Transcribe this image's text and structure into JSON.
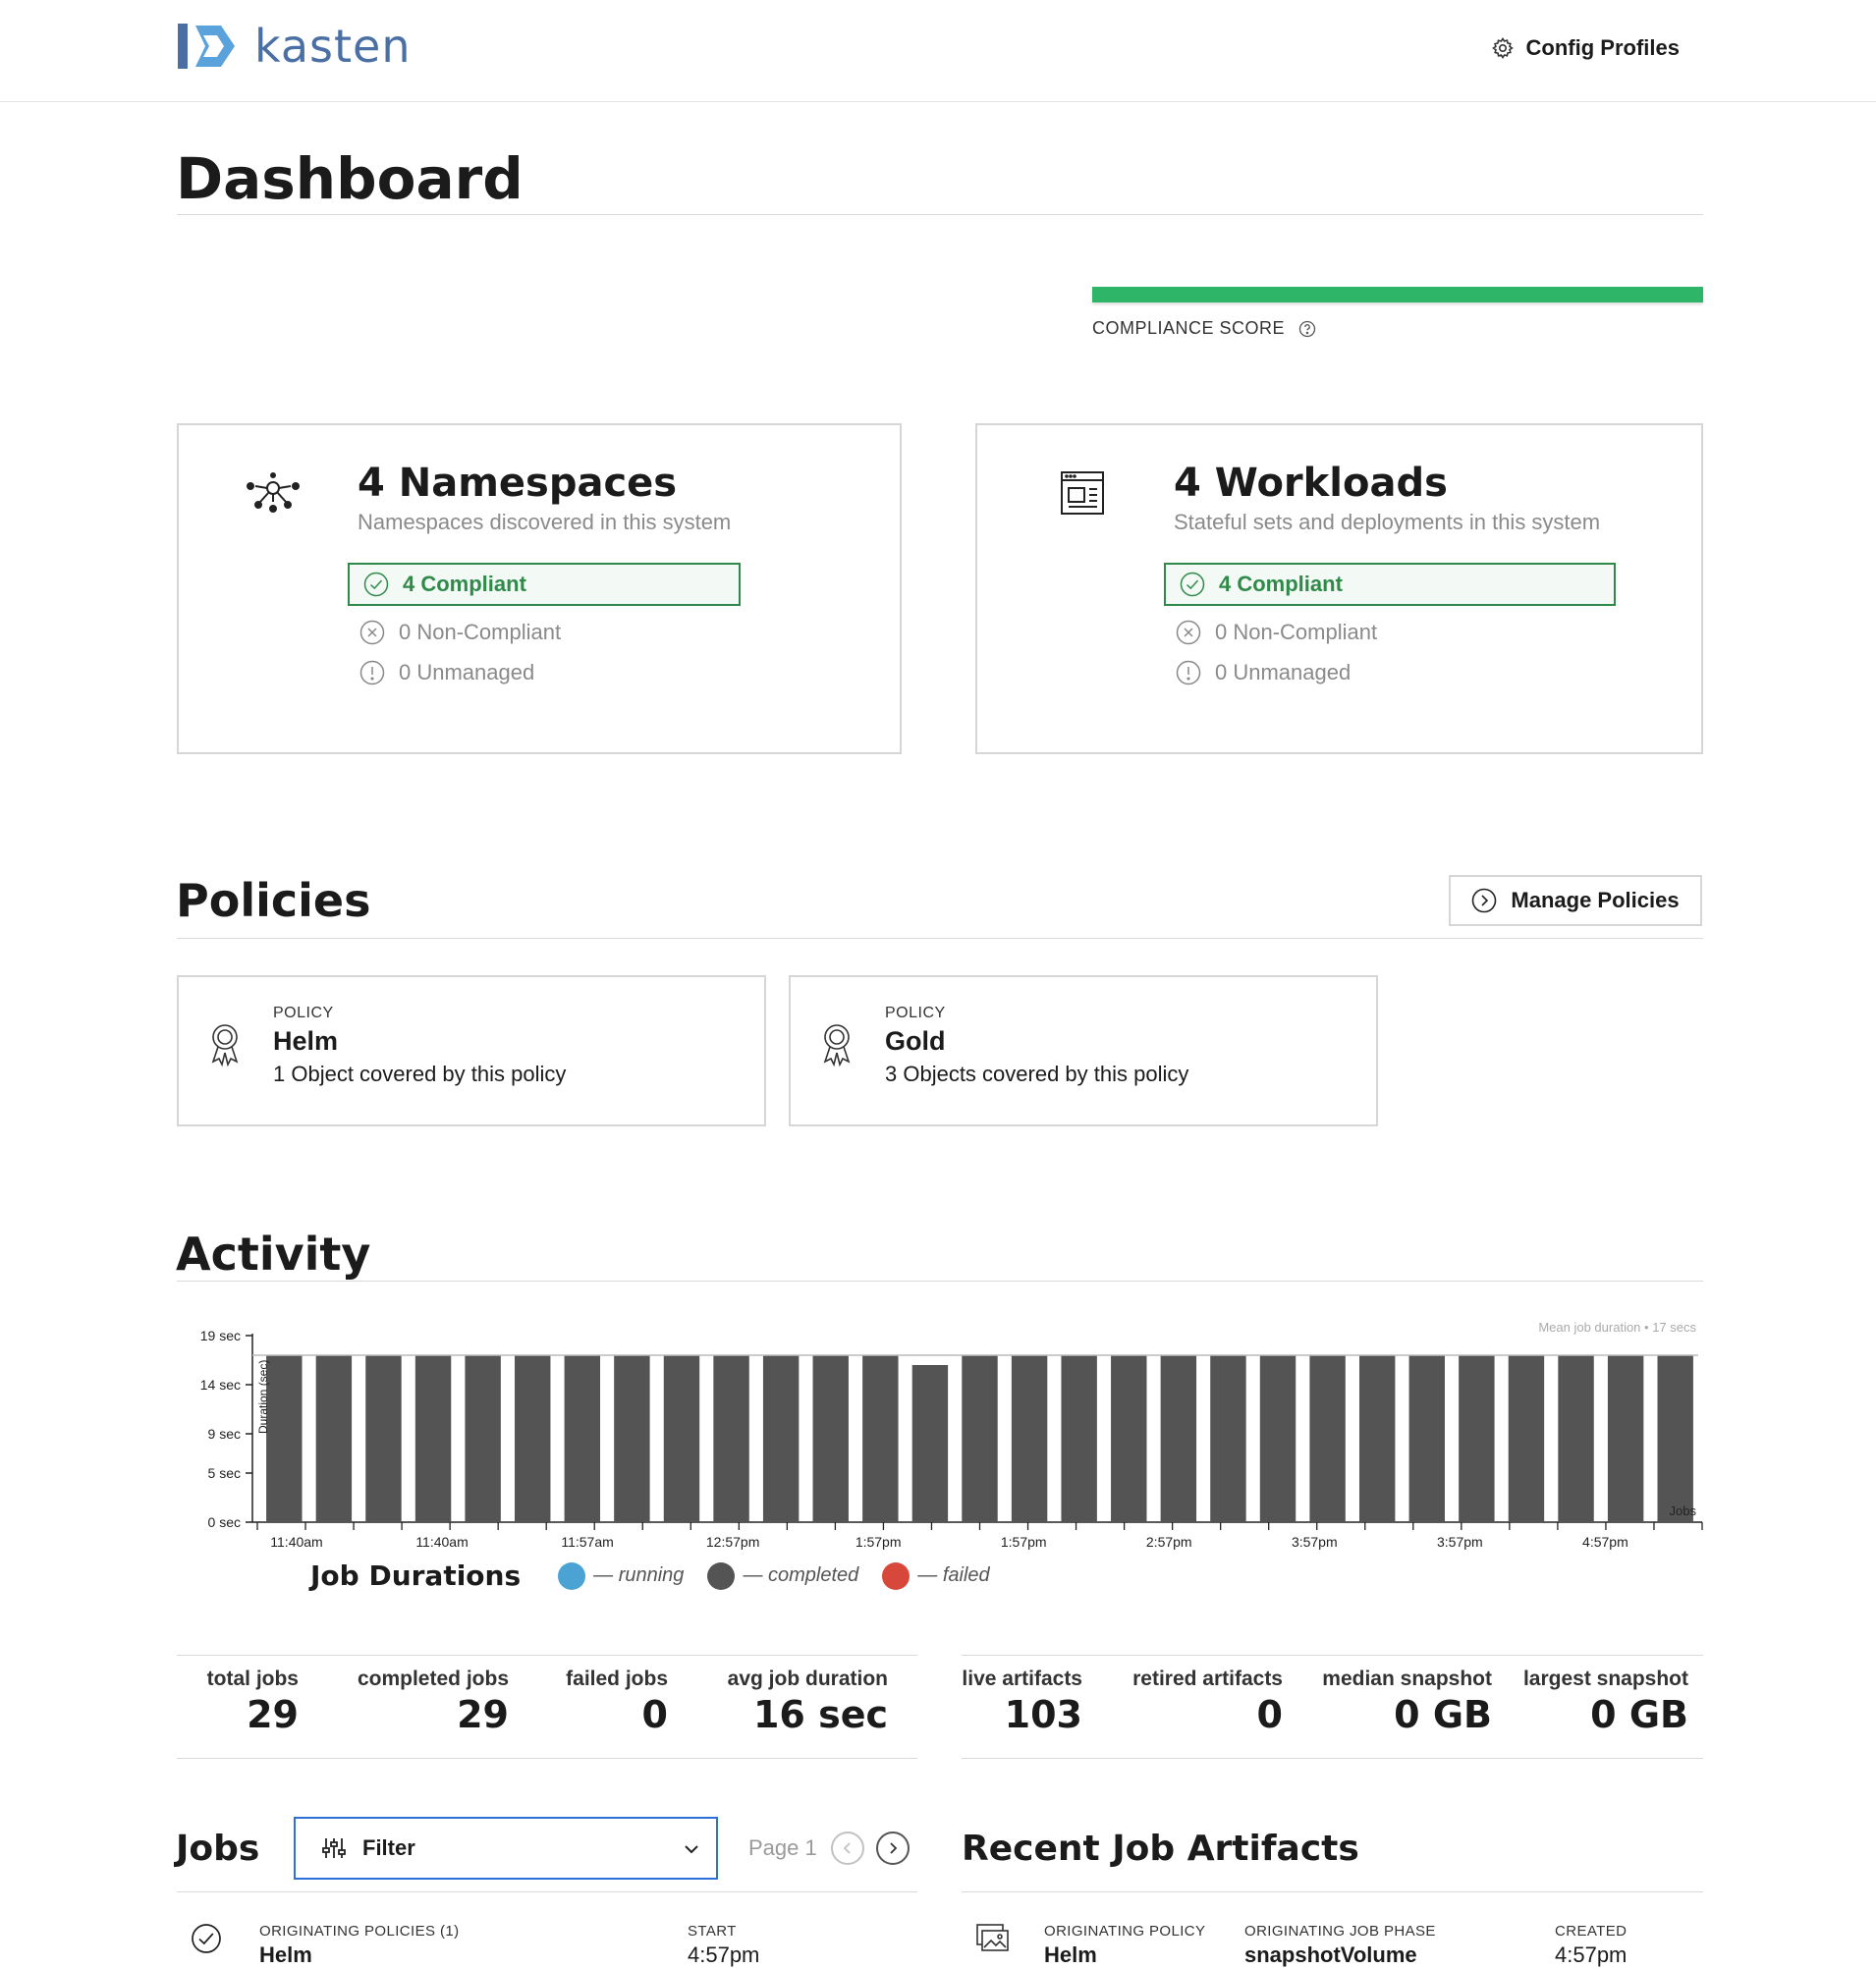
{
  "brand": {
    "name": "kasten"
  },
  "nav": {
    "config_profiles": "Config Profiles"
  },
  "dashboard": {
    "title": "Dashboard",
    "compliance": {
      "label": "COMPLIANCE SCORE",
      "score_fraction": 1.0,
      "color": "#2eb567"
    }
  },
  "namespaces": {
    "title": "4 Namespaces",
    "subtitle": "Namespaces discovered in this system",
    "compliant": "4 Compliant",
    "non_compliant": "0 Non-Compliant",
    "unmanaged": "0 Unmanaged"
  },
  "workloads": {
    "title": "4 Workloads",
    "subtitle": "Stateful sets and deployments in this system",
    "compliant": "4 Compliant",
    "non_compliant": "0 Non-Compliant",
    "unmanaged": "0 Unmanaged"
  },
  "policies": {
    "title": "Policies",
    "manage_button": "Manage Policies",
    "items": [
      {
        "kicker": "POLICY",
        "name": "Helm",
        "desc": "1 Object covered by this policy"
      },
      {
        "kicker": "POLICY",
        "name": "Gold",
        "desc": "3 Objects covered by this policy"
      }
    ]
  },
  "activity": {
    "title": "Activity",
    "legend_title": "Job Durations",
    "legend": [
      {
        "label": "— running",
        "color": "#4aa3d3"
      },
      {
        "label": "— completed",
        "color": "#545454"
      },
      {
        "label": "— failed",
        "color": "#d8483a"
      }
    ]
  },
  "chart_data": {
    "type": "bar",
    "title": "Job Durations",
    "ylabel": "Duration (sec)",
    "xlabel": "Jobs",
    "annotation": "Mean job duration • 17 secs",
    "ylim": [
      0,
      19
    ],
    "y_ticks": [
      "0 sec",
      "5 sec",
      "9 sec",
      "14 sec",
      "19 sec"
    ],
    "y_tick_values": [
      0,
      5,
      9,
      14,
      19
    ],
    "x_ticks": [
      "11:40am",
      "11:40am",
      "11:57am",
      "12:57pm",
      "1:57pm",
      "1:57pm",
      "2:57pm",
      "3:57pm",
      "3:57pm",
      "4:57pm"
    ],
    "mean": 17,
    "bar_color": "#545454",
    "values": [
      17,
      17,
      17,
      17,
      17,
      17,
      17,
      17,
      17,
      17,
      17,
      17,
      17,
      16,
      17,
      17,
      17,
      17,
      17,
      17,
      17,
      17,
      17,
      17,
      17,
      17,
      17,
      17,
      17
    ]
  },
  "job_stats": [
    {
      "label": "total jobs",
      "value": "29"
    },
    {
      "label": "completed jobs",
      "value": "29"
    },
    {
      "label": "failed jobs",
      "value": "0"
    },
    {
      "label": "avg job duration",
      "value": "16 sec"
    }
  ],
  "artifact_stats": [
    {
      "label": "live artifacts",
      "value": "103"
    },
    {
      "label": "retired artifacts",
      "value": "0"
    },
    {
      "label": "median snapshot",
      "value": "0 GB"
    },
    {
      "label": "largest snapshot",
      "value": "0 GB"
    }
  ],
  "jobs": {
    "title": "Jobs",
    "filter_label": "Filter",
    "page_label": "Page 1",
    "row": {
      "policies_label": "ORIGINATING POLICIES (1)",
      "policies_value": "Helm",
      "start_label": "START",
      "start_value": "4:57pm"
    }
  },
  "artifacts": {
    "title": "Recent Job Artifacts",
    "row": {
      "policy_label": "ORIGINATING POLICY",
      "policy_value": "Helm",
      "phase_label": "ORIGINATING JOB PHASE",
      "phase_value": "snapshotVolume",
      "created_label": "CREATED",
      "created_value": "4:57pm"
    }
  }
}
